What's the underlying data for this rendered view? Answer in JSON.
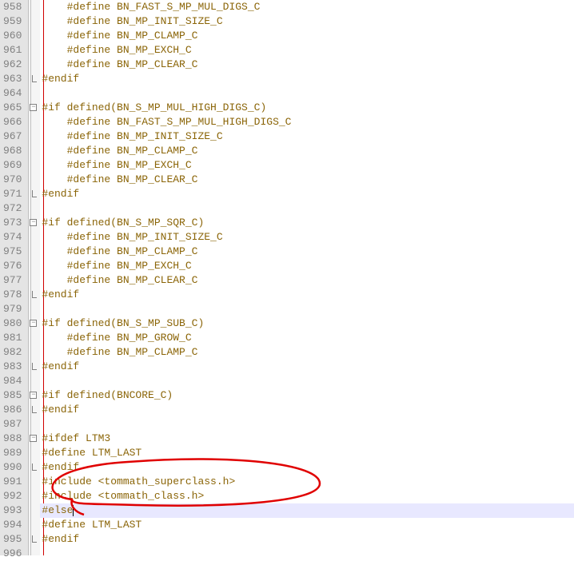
{
  "lines": [
    {
      "n": 958,
      "indent": 4,
      "t": "#define BN_FAST_S_MP_MUL_DIGS_C",
      "fold": ""
    },
    {
      "n": 959,
      "indent": 4,
      "t": "#define BN_MP_INIT_SIZE_C",
      "fold": ""
    },
    {
      "n": 960,
      "indent": 4,
      "t": "#define BN_MP_CLAMP_C",
      "fold": ""
    },
    {
      "n": 961,
      "indent": 4,
      "t": "#define BN_MP_EXCH_C",
      "fold": ""
    },
    {
      "n": 962,
      "indent": 4,
      "t": "#define BN_MP_CLEAR_C",
      "fold": ""
    },
    {
      "n": 963,
      "indent": 0,
      "t": "#endif",
      "fold": "end"
    },
    {
      "n": 964,
      "indent": 0,
      "t": "",
      "fold": ""
    },
    {
      "n": 965,
      "indent": 0,
      "t": "#if defined(BN_S_MP_MUL_HIGH_DIGS_C)",
      "fold": "open"
    },
    {
      "n": 966,
      "indent": 4,
      "t": "#define BN_FAST_S_MP_MUL_HIGH_DIGS_C",
      "fold": ""
    },
    {
      "n": 967,
      "indent": 4,
      "t": "#define BN_MP_INIT_SIZE_C",
      "fold": ""
    },
    {
      "n": 968,
      "indent": 4,
      "t": "#define BN_MP_CLAMP_C",
      "fold": ""
    },
    {
      "n": 969,
      "indent": 4,
      "t": "#define BN_MP_EXCH_C",
      "fold": ""
    },
    {
      "n": 970,
      "indent": 4,
      "t": "#define BN_MP_CLEAR_C",
      "fold": ""
    },
    {
      "n": 971,
      "indent": 0,
      "t": "#endif",
      "fold": "end"
    },
    {
      "n": 972,
      "indent": 0,
      "t": "",
      "fold": ""
    },
    {
      "n": 973,
      "indent": 0,
      "t": "#if defined(BN_S_MP_SQR_C)",
      "fold": "open"
    },
    {
      "n": 974,
      "indent": 4,
      "t": "#define BN_MP_INIT_SIZE_C",
      "fold": ""
    },
    {
      "n": 975,
      "indent": 4,
      "t": "#define BN_MP_CLAMP_C",
      "fold": ""
    },
    {
      "n": 976,
      "indent": 4,
      "t": "#define BN_MP_EXCH_C",
      "fold": ""
    },
    {
      "n": 977,
      "indent": 4,
      "t": "#define BN_MP_CLEAR_C",
      "fold": ""
    },
    {
      "n": 978,
      "indent": 0,
      "t": "#endif",
      "fold": "end"
    },
    {
      "n": 979,
      "indent": 0,
      "t": "",
      "fold": ""
    },
    {
      "n": 980,
      "indent": 0,
      "t": "#if defined(BN_S_MP_SUB_C)",
      "fold": "open"
    },
    {
      "n": 981,
      "indent": 4,
      "t": "#define BN_MP_GROW_C",
      "fold": ""
    },
    {
      "n": 982,
      "indent": 4,
      "t": "#define BN_MP_CLAMP_C",
      "fold": ""
    },
    {
      "n": 983,
      "indent": 0,
      "t": "#endif",
      "fold": "end"
    },
    {
      "n": 984,
      "indent": 0,
      "t": "",
      "fold": ""
    },
    {
      "n": 985,
      "indent": 0,
      "t": "#if defined(BNCORE_C)",
      "fold": "open"
    },
    {
      "n": 986,
      "indent": 0,
      "t": "#endif",
      "fold": "end"
    },
    {
      "n": 987,
      "indent": 0,
      "t": "",
      "fold": ""
    },
    {
      "n": 988,
      "indent": 0,
      "t": "#ifdef LTM3",
      "fold": "open"
    },
    {
      "n": 989,
      "indent": 0,
      "t": "#define LTM_LAST",
      "fold": ""
    },
    {
      "n": 990,
      "indent": 0,
      "t": "#endif",
      "fold": "end"
    },
    {
      "n": 991,
      "indent": 0,
      "t": "#include <tommath_superclass.h>",
      "fold": ""
    },
    {
      "n": 992,
      "indent": 0,
      "t": "#include <tommath_class.h>",
      "fold": ""
    },
    {
      "n": 993,
      "indent": 0,
      "t": "#else",
      "fold": "",
      "hl": true,
      "cursor": true
    },
    {
      "n": 994,
      "indent": 0,
      "t": "#define LTM_LAST",
      "fold": ""
    },
    {
      "n": 995,
      "indent": 0,
      "t": "#endif",
      "fold": "end"
    },
    {
      "n": 996,
      "indent": 0,
      "t": "",
      "fold": ""
    }
  ],
  "colors": {
    "keyword": "#8B6508"
  }
}
